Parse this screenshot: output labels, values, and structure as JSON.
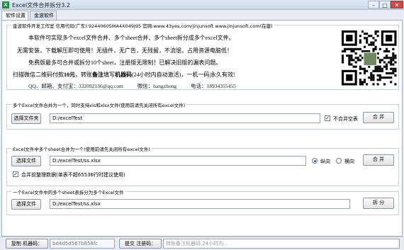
{
  "window": {
    "title": "Excel文件合并拆分3.2",
    "minimize": "–",
    "maximize": "□",
    "close": "✕"
  },
  "tabs": [
    {
      "label": "软件设置",
      "active": true
    },
    {
      "label": "金波软件",
      "active": false
    }
  ],
  "info": {
    "group_title": "金波软件开发工作室  信用代码(广东):92440605MA4X049J95  官网:www.43yes.com/jinjunsoft   www.jinjunsoft.com(在建)",
    "line1": "本软件可实现多个excel文件合并、多个sheet合并、多个sheet拆分成多个excel文件。",
    "line2": "无需安装，下载解压即可使用！无插件，无广告，无残留，不流氓，占用资源电脑低！",
    "line3": "免费版最多可合并或拆分10个sheet，注册版无限制！已解决旧版的漏表问题。",
    "line4_pre": "扫描微信二维码付款",
    "line4_amount": "10元",
    "line4_mid": "，转账",
    "line4_note": "备注",
    "line4_mid2": "填写",
    "line4_code": "机器码",
    "line4_post": "(24小时内自动激活)，一机一码|永久有效!",
    "qq": "QQ、邮箱、支付宝：332092136@qq.com",
    "wechat": "微信：hangzhong",
    "phone": "电话：18934355455"
  },
  "merge_files": {
    "group_title": "多个Excel文件合并为一个，同时支持xls和xlsx文件(使用前请先关闭所有excel文件)",
    "select_button": "选择文件夹",
    "path": "D:/excelTest",
    "checkbox_label": "不合并空表",
    "checkbox_checked": true,
    "action_button": "合 并"
  },
  "merge_sheets": {
    "group_title": "Excel文件中多个sheet合并为一个(使用前请先关闭所有excel文件)",
    "select_button": "选择文件",
    "path": "D:/excelTest/ss.xlsx",
    "radio_vertical": "纵向",
    "radio_horizontal": "横向",
    "vertical_selected": true,
    "checkbox_label": "合并前整理数据(单表不超65536行时建议使用)",
    "checkbox_checked": true,
    "action_button": "合 并"
  },
  "split_sheets": {
    "group_title": "一个Excel文件中的多个sheet表拆分为多个Excel文件",
    "select_button": "选择文件",
    "path": "D:/excelTest/ss.xlsx",
    "action_button": "拆 分"
  },
  "status": {
    "copy_label": "复制 机器码：",
    "machine_code": "bd4d5d567b858fc",
    "submit_label": "提交 注册码：",
    "register_hint": "转账备注机器码,24小时内..."
  }
}
